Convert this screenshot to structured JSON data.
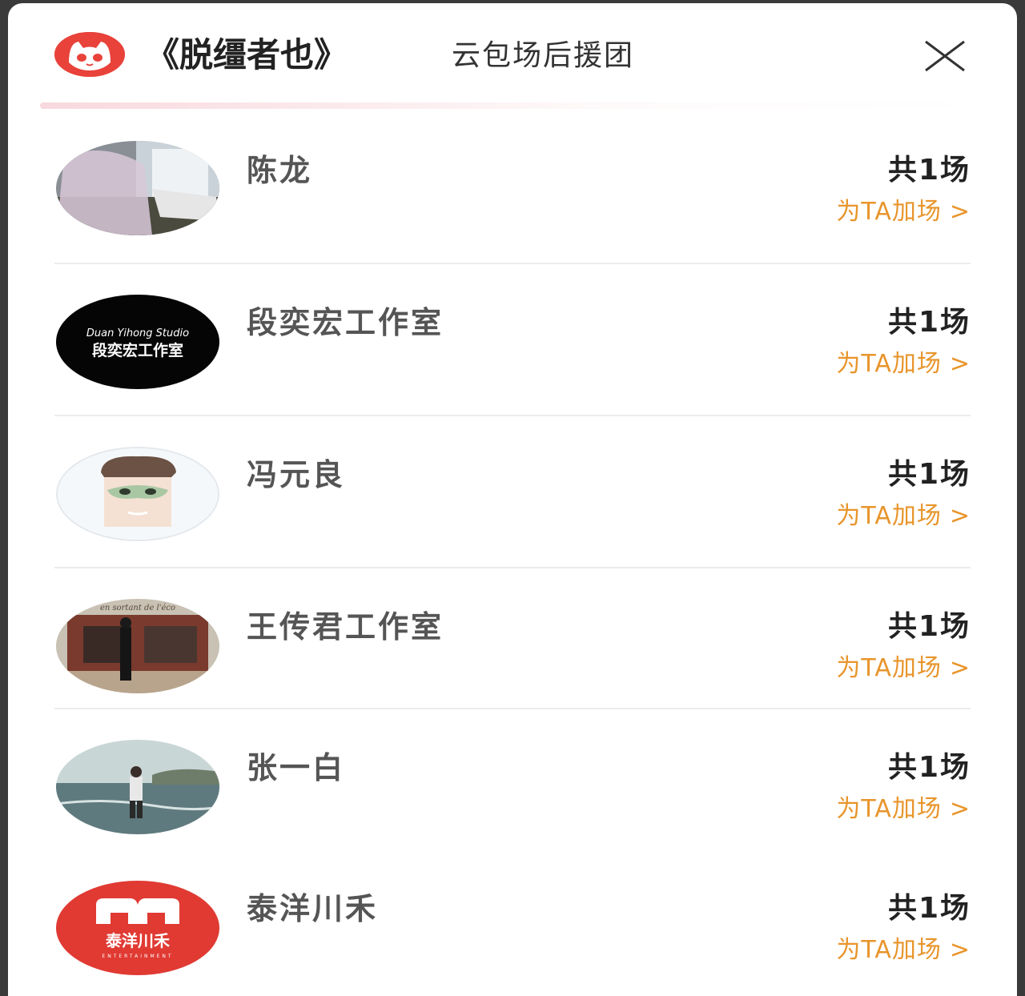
{
  "header": {
    "title": "《脱缰者也》",
    "subtitle": "云包场后援团"
  },
  "rows": [
    {
      "name": "陈龙",
      "count": "共1场",
      "action": "为TA加场"
    },
    {
      "name": "段奕宏工作室",
      "count": "共1场",
      "action": "为TA加场",
      "avatar_text_top": "Duan Yihong Studio",
      "avatar_text_main": "段奕宏工作室"
    },
    {
      "name": "冯元良",
      "count": "共1场",
      "action": "为TA加场"
    },
    {
      "name": "王传君工作室",
      "count": "共1场",
      "action": "为TA加场",
      "avatar_text_top": "en sortant de l'éco"
    },
    {
      "name": "张一白",
      "count": "共1场",
      "action": "为TA加场"
    },
    {
      "name": "泰洋川禾",
      "count": "共1场",
      "action": "为TA加场",
      "avatar_text_main": "泰洋川禾",
      "avatar_text_small": "ENTERTAINMENT"
    }
  ],
  "chevron": ">",
  "colors": {
    "brand_red": "#e8423a",
    "action_orange": "#e8952c",
    "text_dark": "#222222",
    "name_gray": "#555555"
  },
  "icons": {
    "logo": "cat-logo-icon",
    "close": "close-icon",
    "chevron": "chevron-right-icon"
  }
}
